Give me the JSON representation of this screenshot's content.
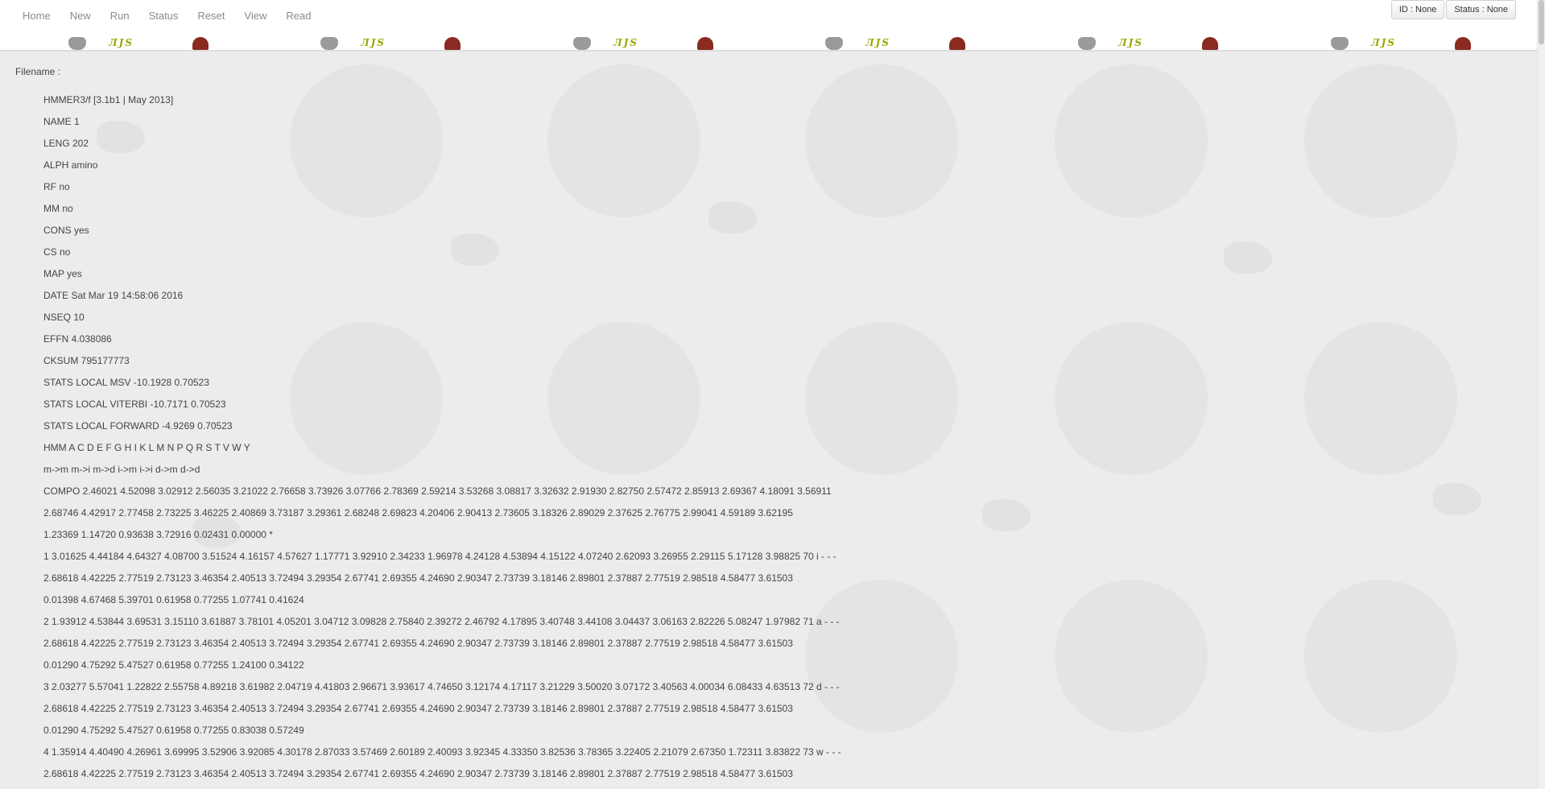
{
  "nav": {
    "links": [
      "Home",
      "New",
      "Run",
      "Status",
      "Reset",
      "View",
      "Read"
    ],
    "id_button": "ID : None",
    "status_button": "Status : None"
  },
  "banner": {
    "mark_text": "ЛJS"
  },
  "main": {
    "filename_label": "Filename :",
    "lines": [
      "HMMER3/f [3.1b1 | May 2013]",
      "NAME 1",
      "LENG 202",
      "ALPH amino",
      "RF no",
      "MM no",
      "CONS yes",
      "CS no",
      "MAP yes",
      "DATE Sat Mar 19 14:58:06 2016",
      "NSEQ 10",
      "EFFN 4.038086",
      "CKSUM 795177773",
      "STATS LOCAL MSV -10.1928 0.70523",
      "STATS LOCAL VITERBI -10.7171 0.70523",
      "STATS LOCAL FORWARD -4.9269 0.70523",
      "HMM A C D E F G H I K L M N P Q R S T V W Y",
      "m->m m->i m->d i->m i->i d->m d->d",
      "COMPO 2.46021 4.52098 3.02912 2.56035 3.21022 2.76658 3.73926 3.07766 2.78369 2.59214 3.53268 3.08817 3.32632 2.91930 2.82750 2.57472 2.85913 2.69367 4.18091 3.56911",
      "2.68746 4.42917 2.77458 2.73225 3.46225 2.40869 3.73187 3.29361 2.68248 2.69823 4.20406 2.90413 2.73605 3.18326 2.89029 2.37625 2.76775 2.99041 4.59189 3.62195",
      "1.23369 1.14720 0.93638 3.72916 0.02431 0.00000 *",
      "1 3.01625 4.44184 4.64327 4.08700 3.51524 4.16157 4.57627 1.17771 3.92910 2.34233 1.96978 4.24128 4.53894 4.15122 4.07240 2.62093 3.26955 2.29115 5.17128 3.98825 70 i - - -",
      "2.68618 4.42225 2.77519 2.73123 3.46354 2.40513 3.72494 3.29354 2.67741 2.69355 4.24690 2.90347 2.73739 3.18146 2.89801 2.37887 2.77519 2.98518 4.58477 3.61503",
      "0.01398 4.67468 5.39701 0.61958 0.77255 1.07741 0.41624",
      "2 1.93912 4.53844 3.69531 3.15110 3.61887 3.78101 4.05201 3.04712 3.09828 2.75840 2.39272 2.46792 4.17895 3.40748 3.44108 3.04437 3.06163 2.82226 5.08247 1.97982 71 a - - -",
      "2.68618 4.42225 2.77519 2.73123 3.46354 2.40513 3.72494 3.29354 2.67741 2.69355 4.24690 2.90347 2.73739 3.18146 2.89801 2.37887 2.77519 2.98518 4.58477 3.61503",
      "0.01290 4.75292 5.47527 0.61958 0.77255 1.24100 0.34122",
      "3 2.03277 5.57041 1.22822 2.55758 4.89218 3.61982 2.04719 4.41803 2.96671 3.93617 4.74650 3.12174 4.17117 3.21229 3.50020 3.07172 3.40563 4.00034 6.08433 4.63513 72 d - - -",
      "2.68618 4.42225 2.77519 2.73123 3.46354 2.40513 3.72494 3.29354 2.67741 2.69355 4.24690 2.90347 2.73739 3.18146 2.89801 2.37887 2.77519 2.98518 4.58477 3.61503",
      "0.01290 4.75292 5.47527 0.61958 0.77255 0.83038 0.57249",
      "4 1.35914 4.40490 4.26961 3.69995 3.52906 3.92085 4.30178 2.87033 3.57469 2.60189 2.40093 3.92345 4.33350 3.82536 3.78365 3.22405 2.21079 2.67350 1.72311 3.83822 73 w - - -",
      "2.68618 4.42225 2.77519 2.73123 3.46354 2.40513 3.72494 3.29354 2.67741 2.69355 4.24690 2.90347 2.73739 3.18146 2.89801 2.37887 2.77519 2.98518 4.58477 3.61503"
    ]
  }
}
